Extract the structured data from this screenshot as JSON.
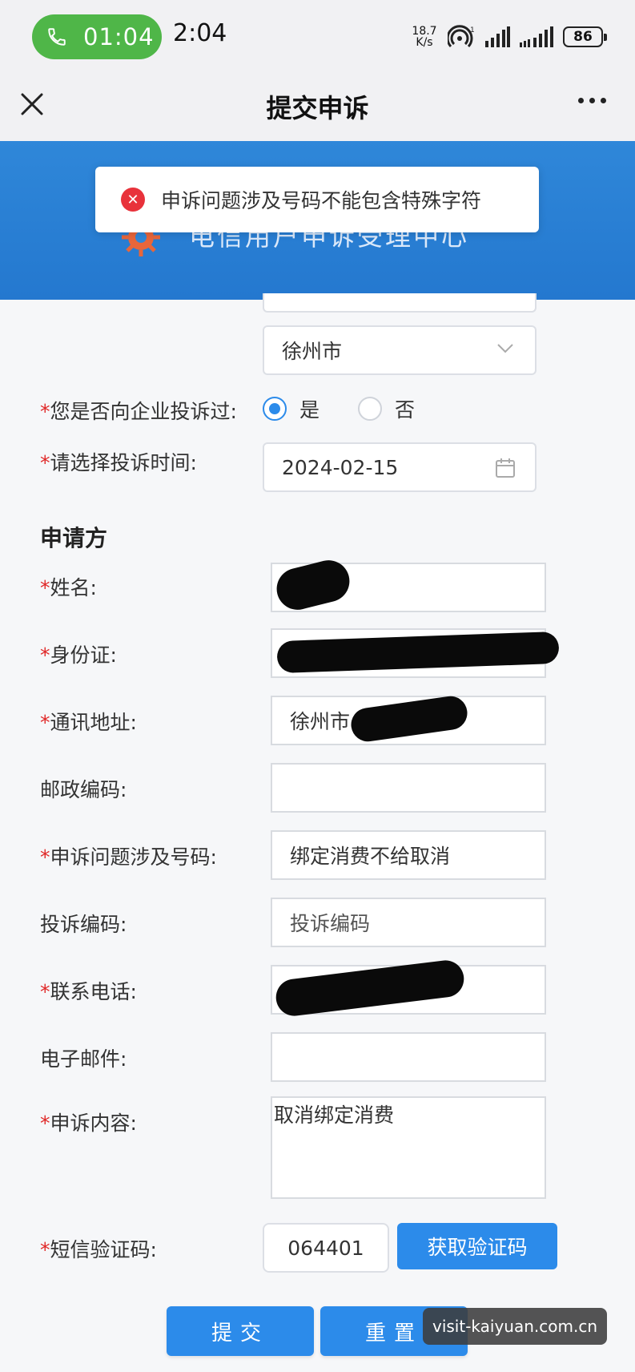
{
  "status_bar": {
    "call_timer": "01:04",
    "clock": "2:04",
    "net_speed_value": "18.7",
    "net_speed_unit": "K/s",
    "battery": "86"
  },
  "header": {
    "title": "提交申诉"
  },
  "banner": {
    "text": "电信用户申诉受理中心"
  },
  "toast": {
    "message": "申诉问题涉及号码不能包含特殊字符"
  },
  "form": {
    "city_select": "徐州市",
    "complained_label": "您是否向企业投诉过:",
    "radio_yes": "是",
    "radio_no": "否",
    "radio_selected": "是",
    "time_label": "请选择投诉时间:",
    "time_value": "2024-02-15",
    "section_applicant": "申请方",
    "required_mark": "*",
    "fields": {
      "name_label": "姓名:",
      "id_label": "身份证:",
      "address_label": "通讯地址:",
      "address_value": "徐州市",
      "postcode_label": "邮政编码:",
      "number_label": "申诉问题涉及号码:",
      "number_value": "绑定消费不给取消",
      "complaint_code_label": "投诉编码:",
      "complaint_code_placeholder": "投诉编码",
      "phone_label": "联系电话:",
      "email_label": "电子邮件:",
      "content_label": "申诉内容:",
      "content_value": "取消绑定消费",
      "sms_label": "短信验证码:",
      "sms_value": "064401",
      "sms_button": "获取验证码"
    },
    "submit_button": "提交",
    "reset_button": "重置"
  },
  "watermark": "visit-kaiyuan.com.cn",
  "colors": {
    "primary": "#2c8bea",
    "error": "#e8323b",
    "call_green": "#4fb648",
    "banner": "#2f87d9"
  }
}
